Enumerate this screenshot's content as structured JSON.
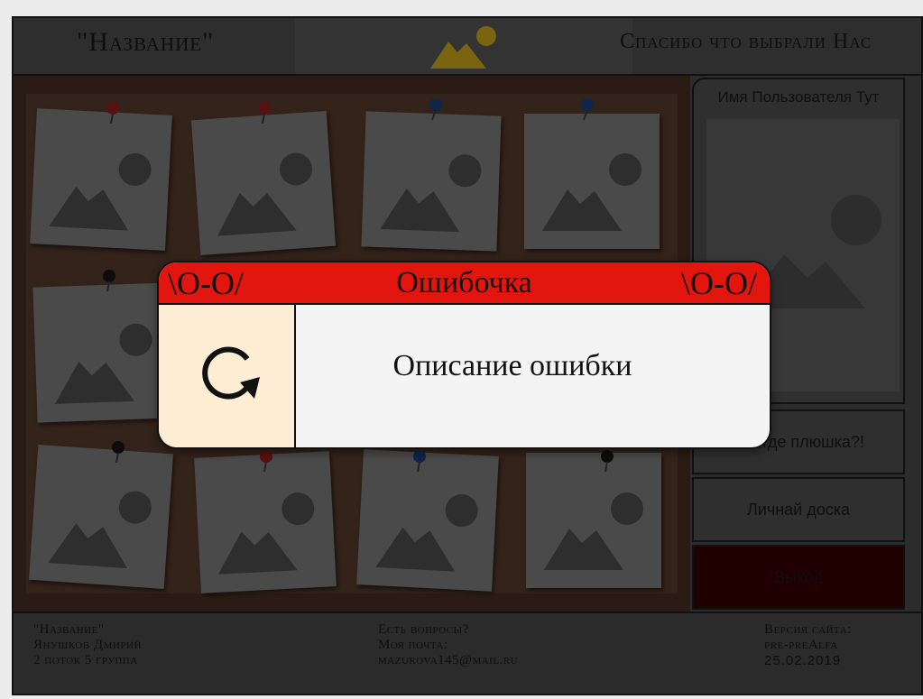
{
  "header": {
    "title": "\"Название\"",
    "tagline": "Спасибо что выбрали Нас"
  },
  "profile": {
    "username": "Имя Пользователя Тут"
  },
  "sidebar": {
    "plushka_label": "…а где плюшка?!",
    "board_label": "Личнай доска",
    "exit_label": "Выход"
  },
  "footer": {
    "col1": {
      "line1": "\"Название\"",
      "line2": "Янушков Дмирий",
      "line3": "2 поток 5 группа"
    },
    "col2": {
      "line1": "Есть вопросы?",
      "line2": "Моя почта:",
      "line3": "mazurova145@mail.ru"
    },
    "col3": {
      "line1": "Версия сайта:",
      "line2": "pre-preAlfa",
      "line3": "25.02.2019"
    }
  },
  "modal": {
    "face_left": "\\O-O/",
    "title": "Ошибочка",
    "face_right": "\\O-O/",
    "message": "Описание ошибки",
    "icon": "reload-icon"
  },
  "colors": {
    "modal_header": "#e2150f",
    "modal_icon_bg": "#fcedd4",
    "logo": "#7a6410",
    "exit_bg": "#200000"
  },
  "board": {
    "pins": [
      "red",
      "red",
      "blue",
      "blue",
      "black",
      "none",
      "none",
      "none",
      "black",
      "red",
      "blue",
      "black"
    ]
  }
}
